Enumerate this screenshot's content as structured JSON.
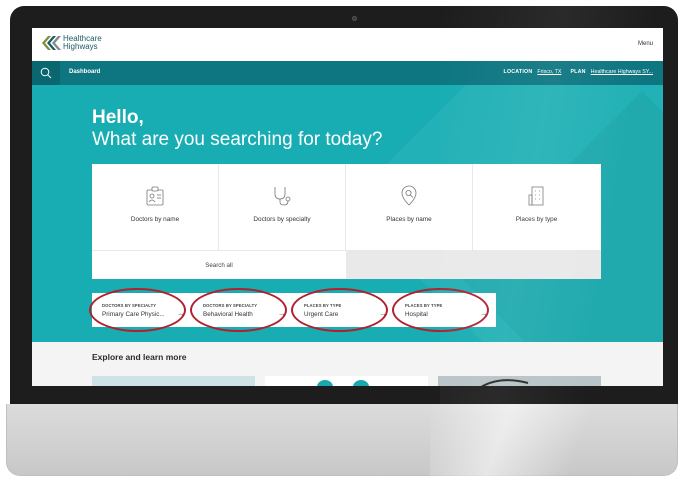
{
  "header": {
    "logo_line1": "Healthcare",
    "logo_line2": "Highways",
    "menu_label": "Menu"
  },
  "navbar": {
    "title": "Dashboard",
    "location_label": "LOCATION",
    "location_value": "Frisco, TX",
    "plan_label": "PLAN",
    "plan_value": "Healthcare Highways SY..."
  },
  "hero": {
    "greeting": "Hello,",
    "question": "What are you searching for today?"
  },
  "search_cards": [
    {
      "label": "Doctors by name",
      "icon": "doctor-badge-icon"
    },
    {
      "label": "Doctors by specialty",
      "icon": "stethoscope-icon"
    },
    {
      "label": "Places by name",
      "icon": "location-search-icon"
    },
    {
      "label": "Places by type",
      "icon": "building-icon"
    }
  ],
  "search_all_label": "Search all",
  "recent_searches": [
    {
      "category": "DOCTORS BY SPECIALTY",
      "value": "Primary Care Physic..."
    },
    {
      "category": "DOCTORS BY SPECIALTY",
      "value": "Behavioral Health"
    },
    {
      "category": "PLACES BY TYPE",
      "value": "Urgent Care"
    },
    {
      "category": "PLACES BY TYPE",
      "value": "Hospital"
    }
  ],
  "explore_title": "Explore and learn more",
  "colors": {
    "teal_nav": "#0d7681",
    "teal_hero": "#17adb3",
    "highlight_ring": "#b1202f"
  }
}
